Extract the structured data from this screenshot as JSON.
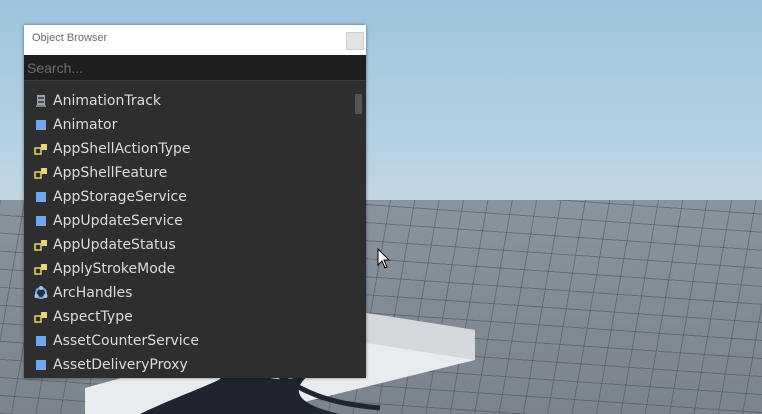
{
  "window": {
    "title": "Object Browser"
  },
  "search": {
    "placeholder": "Search..."
  },
  "items": [
    {
      "label": "AnimationTrack",
      "icon": "animation-track-icon"
    },
    {
      "label": "Animator",
      "icon": "class-square-icon"
    },
    {
      "label": "AppShellActionType",
      "icon": "enum-icon"
    },
    {
      "label": "AppShellFeature",
      "icon": "enum-icon"
    },
    {
      "label": "AppStorageService",
      "icon": "class-square-icon"
    },
    {
      "label": "AppUpdateService",
      "icon": "class-square-icon"
    },
    {
      "label": "AppUpdateStatus",
      "icon": "enum-icon"
    },
    {
      "label": "ApplyStrokeMode",
      "icon": "enum-icon"
    },
    {
      "label": "ArcHandles",
      "icon": "arc-handles-icon"
    },
    {
      "label": "AspectType",
      "icon": "enum-icon"
    },
    {
      "label": "AssetCounterService",
      "icon": "class-square-icon"
    },
    {
      "label": "AssetDeliveryProxy",
      "icon": "class-square-icon"
    }
  ],
  "colors": {
    "panel_bg": "#2e2e2e",
    "text": "#dcdcdc",
    "class_icon": "#6fa8f0",
    "enum_icon": "#e8d26a"
  }
}
